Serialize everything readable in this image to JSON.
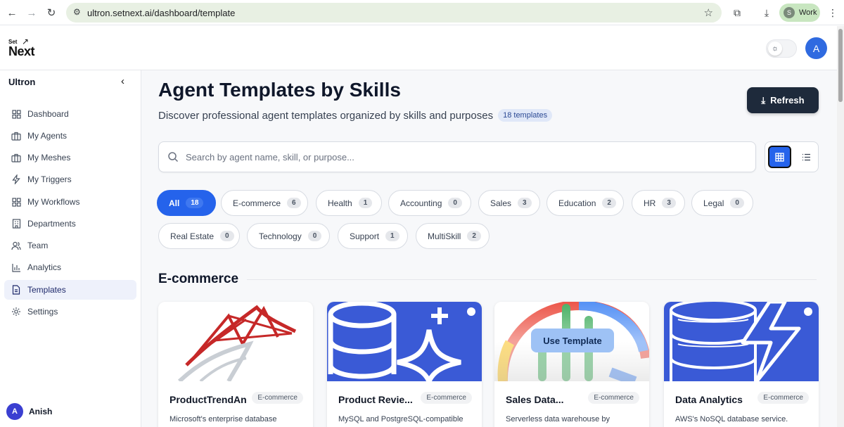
{
  "browser": {
    "url": "ultron.setnext.ai/dashboard/template",
    "profile_initial": "S",
    "profile_label": "Work"
  },
  "header": {
    "logo_top": "Set",
    "logo_bottom": "Next",
    "user_initial": "A"
  },
  "sidebar": {
    "title": "Ultron",
    "items": [
      {
        "label": "Dashboard",
        "icon": "grid-icon"
      },
      {
        "label": "My Agents",
        "icon": "briefcase-icon"
      },
      {
        "label": "My Meshes",
        "icon": "briefcase-icon"
      },
      {
        "label": "My Triggers",
        "icon": "lightning-icon"
      },
      {
        "label": "My Workflows",
        "icon": "grid-icon"
      },
      {
        "label": "Departments",
        "icon": "building-icon"
      },
      {
        "label": "Team",
        "icon": "users-icon"
      },
      {
        "label": "Analytics",
        "icon": "bar-chart-icon"
      },
      {
        "label": "Templates",
        "icon": "document-icon",
        "active": true
      },
      {
        "label": "Settings",
        "icon": "gear-icon"
      }
    ],
    "user": {
      "initial": "A",
      "name": "Anish"
    }
  },
  "main": {
    "title": "Agent Templates by Skills",
    "subtitle": "Discover professional agent templates organized by skills and purposes",
    "count_badge": "18 templates",
    "refresh_label": "Refresh",
    "search_placeholder": "Search by agent name, skill, or purpose...",
    "filters": [
      {
        "label": "All",
        "count": "18",
        "active": true
      },
      {
        "label": "E-commerce",
        "count": "6"
      },
      {
        "label": "Health",
        "count": "1"
      },
      {
        "label": "Accounting",
        "count": "0"
      },
      {
        "label": "Sales",
        "count": "3"
      },
      {
        "label": "Education",
        "count": "2"
      },
      {
        "label": "HR",
        "count": "3"
      },
      {
        "label": "Legal",
        "count": "0"
      },
      {
        "label": "Real Estate",
        "count": "0"
      },
      {
        "label": "Technology",
        "count": "0"
      },
      {
        "label": "Support",
        "count": "1"
      },
      {
        "label": "MultiSkill",
        "count": "2"
      }
    ],
    "section_title": "E-commerce",
    "cards": [
      {
        "name": "ProductTrendAn",
        "tag": "E-commerce",
        "desc": "Microsoft's enterprise database"
      },
      {
        "name": "Product Revie...",
        "tag": "E-commerce",
        "desc": "MySQL and PostgreSQL-compatible"
      },
      {
        "name": "Sales Data...",
        "tag": "E-commerce",
        "desc": "Serverless data warehouse by",
        "hover_button": "Use Template"
      },
      {
        "name": "Data Analytics",
        "tag": "E-commerce",
        "desc": "AWS's NoSQL database service."
      }
    ],
    "colors": {
      "accent": "#2563eb",
      "dark_button": "#1e2a3b"
    }
  }
}
